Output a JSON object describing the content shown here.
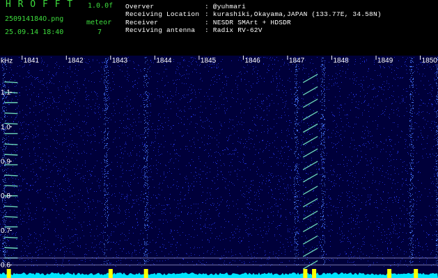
{
  "app": {
    "name": "H R O F F T",
    "version": "1.0.0f",
    "filename": "250914184O.png",
    "datetime": "25.09.14 18:40",
    "meteor_label": "meteor",
    "meteor_count": "7"
  },
  "info": {
    "observer_label": "Overver",
    "observer_value": ": @yuhmari",
    "location_label": "Receiving Location",
    "location_value": ": kurashiki,Okayama,JAPAN (133.77E, 34.58N)",
    "receiver_label": "Receiver",
    "receiver_value": ": NESDR SMArt + HDSDR",
    "antenna_label": "Recviving antenna",
    "antenna_value": ": Radix RV-62V"
  },
  "colors": {
    "background": "#000000",
    "spectrogram_bg": "#00003a",
    "noise": "#2a3cff",
    "echo": "#7fffd0",
    "baseline": "#00e5ff",
    "marker": "#ffff00",
    "title_green": "#3ddc3d"
  },
  "chart_data": {
    "type": "heatmap",
    "y_unit_label": "kHz",
    "y_ticks": [
      "1.1",
      "1.0",
      "0.9",
      "0.8",
      "0.7",
      "0.6"
    ],
    "x_ticks": [
      "1841",
      "1842",
      "1843",
      "1844",
      "1845",
      "1846",
      "1847",
      "1848",
      "1849",
      "1850"
    ],
    "ylim": [
      0.57,
      1.19
    ],
    "xlim": [
      1840.5,
      1850.4
    ],
    "reference_lines_khz": [
      0.62,
      0.6
    ],
    "bright_columns": [
      1840.6,
      1842.9,
      1843.8,
      1847.2,
      1847.8,
      1849.8,
      1850.4
    ],
    "meteor_bursts": [
      1840.7,
      1843.0,
      1843.8,
      1847.4,
      1847.6,
      1849.3,
      1849.9
    ]
  }
}
